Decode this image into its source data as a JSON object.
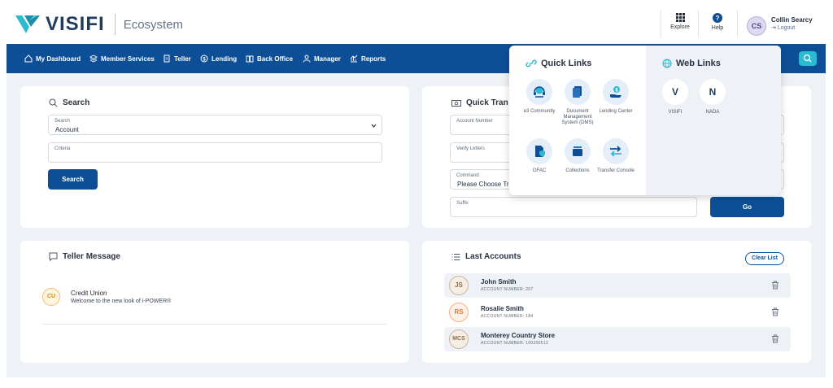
{
  "header": {
    "brand": "VISIFI",
    "product": "Ecosystem",
    "explore_label": "Explore",
    "help_label": "Help",
    "user_initials": "CS",
    "user_name": "Collin Searcy",
    "logout_label": "Logout"
  },
  "nav": {
    "items": [
      {
        "label": "My Dashboard",
        "icon": "home-icon"
      },
      {
        "label": "Member Services",
        "icon": "layers-icon"
      },
      {
        "label": "Teller",
        "icon": "document-icon"
      },
      {
        "label": "Lending",
        "icon": "dollar-circle-icon"
      },
      {
        "label": "Back Office",
        "icon": "book-icon"
      },
      {
        "label": "Manager",
        "icon": "person-icon"
      },
      {
        "label": "Reports",
        "icon": "chart-icon"
      }
    ]
  },
  "search_card": {
    "title": "Search",
    "search_label": "Search",
    "search_value": "Account",
    "criteria_label": "Criteria",
    "button_label": "Search"
  },
  "quick_tran": {
    "title": "Quick Tran",
    "account_number_label": "Account Number",
    "verify_letters_label": "Verify Letters",
    "command_label": "Command",
    "command_value": "Please Choose Tra",
    "suffix_label": "Suffix",
    "go_label": "Go"
  },
  "teller_message": {
    "title": "Teller Message",
    "initials": "CU",
    "from": "Credit Union",
    "message": "Welcome to the new look of i-POWER®"
  },
  "last_accounts": {
    "title": "Last Accounts",
    "clear_label": "Clear List",
    "rows": [
      {
        "initials": "JS",
        "name": "John Smith",
        "number": "ACCOUNT NUMBER: 207"
      },
      {
        "initials": "RS",
        "name": "Rosalie Smith",
        "number": "ACCOUNT NUMBER: 184"
      },
      {
        "initials": "MCS",
        "name": "Monterey Country Store",
        "number": "ACCOUNT NUMBER: 100200513"
      }
    ]
  },
  "explore_popup": {
    "quick_links_title": "Quick Links",
    "web_links_title": "Web Links",
    "quick_links": [
      {
        "label": "e3 Community",
        "icon": "headset-icon"
      },
      {
        "label": "Document Management System (DMS)",
        "icon": "documents-icon"
      },
      {
        "label": "Lending Center",
        "icon": "hand-dollar-icon"
      },
      {
        "label": "OFAC",
        "icon": "shield-document-icon"
      },
      {
        "label": "Collections",
        "icon": "folder-stack-icon"
      },
      {
        "label": "Transfer Console",
        "icon": "transfer-arrows-icon"
      }
    ],
    "web_links": [
      {
        "letter": "V",
        "label": "VISIFI"
      },
      {
        "letter": "N",
        "label": "NADA"
      }
    ]
  },
  "colors": {
    "primary": "#0d4f97",
    "accent": "#2bbbd0",
    "background": "#eef1f5"
  }
}
